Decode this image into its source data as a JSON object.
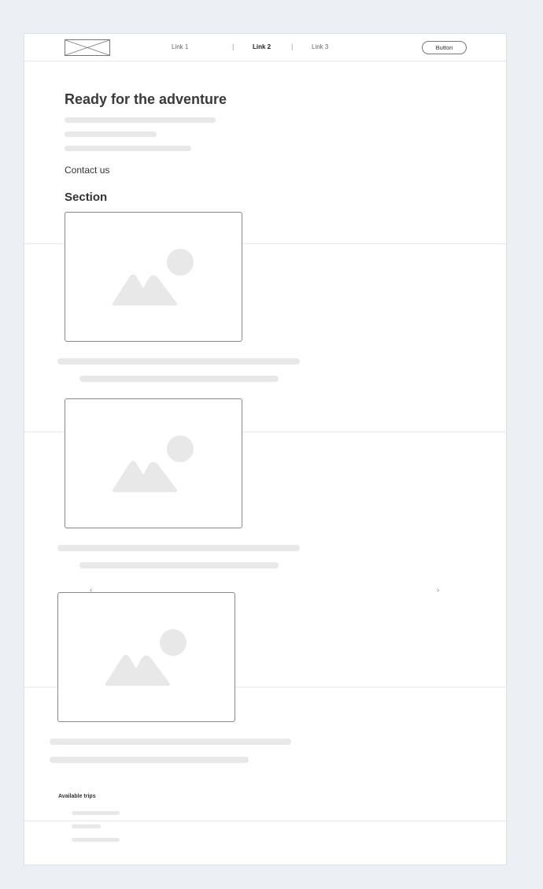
{
  "header": {
    "links": [
      "Link 1",
      "Link 2",
      "Link 3"
    ],
    "separator": "|",
    "button_label": "Button"
  },
  "hero": {
    "title": "Ready for the adventure",
    "contact_label": "Contact us"
  },
  "section": {
    "title": "Section"
  },
  "carousel": {
    "prev_icon": "‹",
    "next_icon": "›"
  },
  "trips": {
    "title": "Available trips"
  },
  "colors": {
    "background": "#eceff4",
    "placeholder": "#e8e8e8",
    "border": "#888888"
  },
  "icons": [
    "logo-placeholder-icon",
    "image-placeholder-icon",
    "chevron-left-icon",
    "chevron-right-icon"
  ]
}
